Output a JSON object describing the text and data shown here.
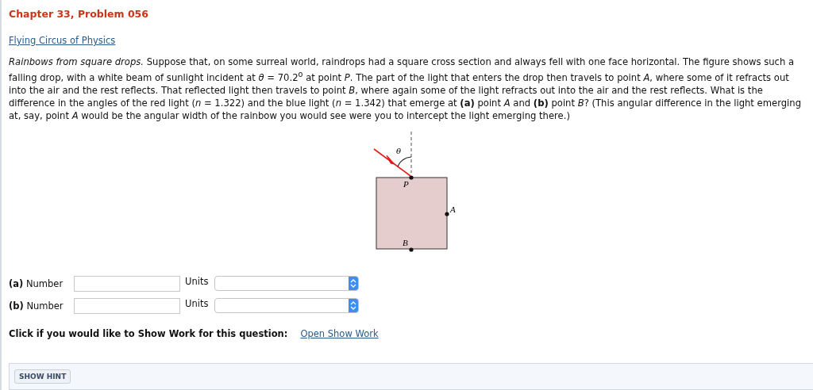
{
  "heading": "Chapter 33, Problem 056",
  "source_link": "Flying Circus of Physics",
  "problem_text": "*Rainbows from square drops.* Suppose that, on some surreal world, raindrops had a square cross section and always fell with one face horizontal. The figure shows such a falling drop, with a white beam of sunlight incident at *θ* = 70.2$^{o}$ at point *P*. The part of the light that enters the drop then travels to point *A*, where some of it refracts out into the air and the rest reflects. That reflected light then travels to point *B*, where again some of the light refracts out into the air and the rest reflects. What is the difference in the angles of the red light (*n* = 1.322) and the blue light (*n* = 1.342) that emerge at **(a)** point *A* and **(b)** point *B*? (This angular difference in the light emerging at, say, point *A* would be the angular width of the rainbow you would see were you to intercept the light emerging there.)",
  "figure": {
    "angle_label": "θ",
    "labels": [
      "P",
      "A",
      "B"
    ]
  },
  "answers": [
    {
      "label": "**(a)** Number",
      "units_label": "Units"
    },
    {
      "label": "**(b)** Number",
      "units_label": "Units"
    }
  ],
  "show_work": {
    "prompt": "Click if you would like to Show Work for this question:",
    "link": "Open Show Work"
  },
  "hint_button": "SHOW HINT"
}
